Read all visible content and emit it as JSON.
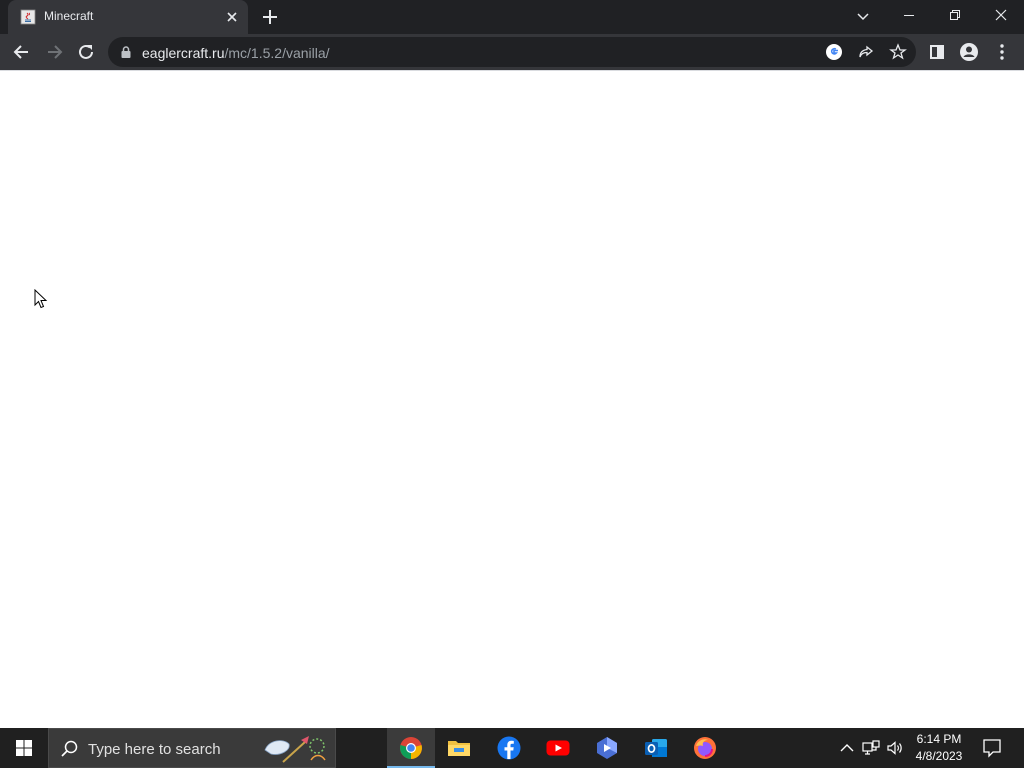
{
  "browser": {
    "tab_title": "Minecraft",
    "url_host": "eaglercraft.ru",
    "url_path": "/mc/1.5.2/vanilla/"
  },
  "taskbar": {
    "search_placeholder": "Type here to search",
    "apps": [
      "chrome-icon",
      "file-explorer-icon",
      "facebook-icon",
      "youtube-icon",
      "azure-data-studio-icon",
      "outlook-icon",
      "firefox-icon"
    ],
    "active_app": "chrome-icon",
    "time": "6:14 PM",
    "date": "4/8/2023"
  },
  "colors": {
    "tabstrip": "#202124",
    "toolbar": "#35363a",
    "taskbar": "#202020",
    "accent": "#76b9ed"
  }
}
